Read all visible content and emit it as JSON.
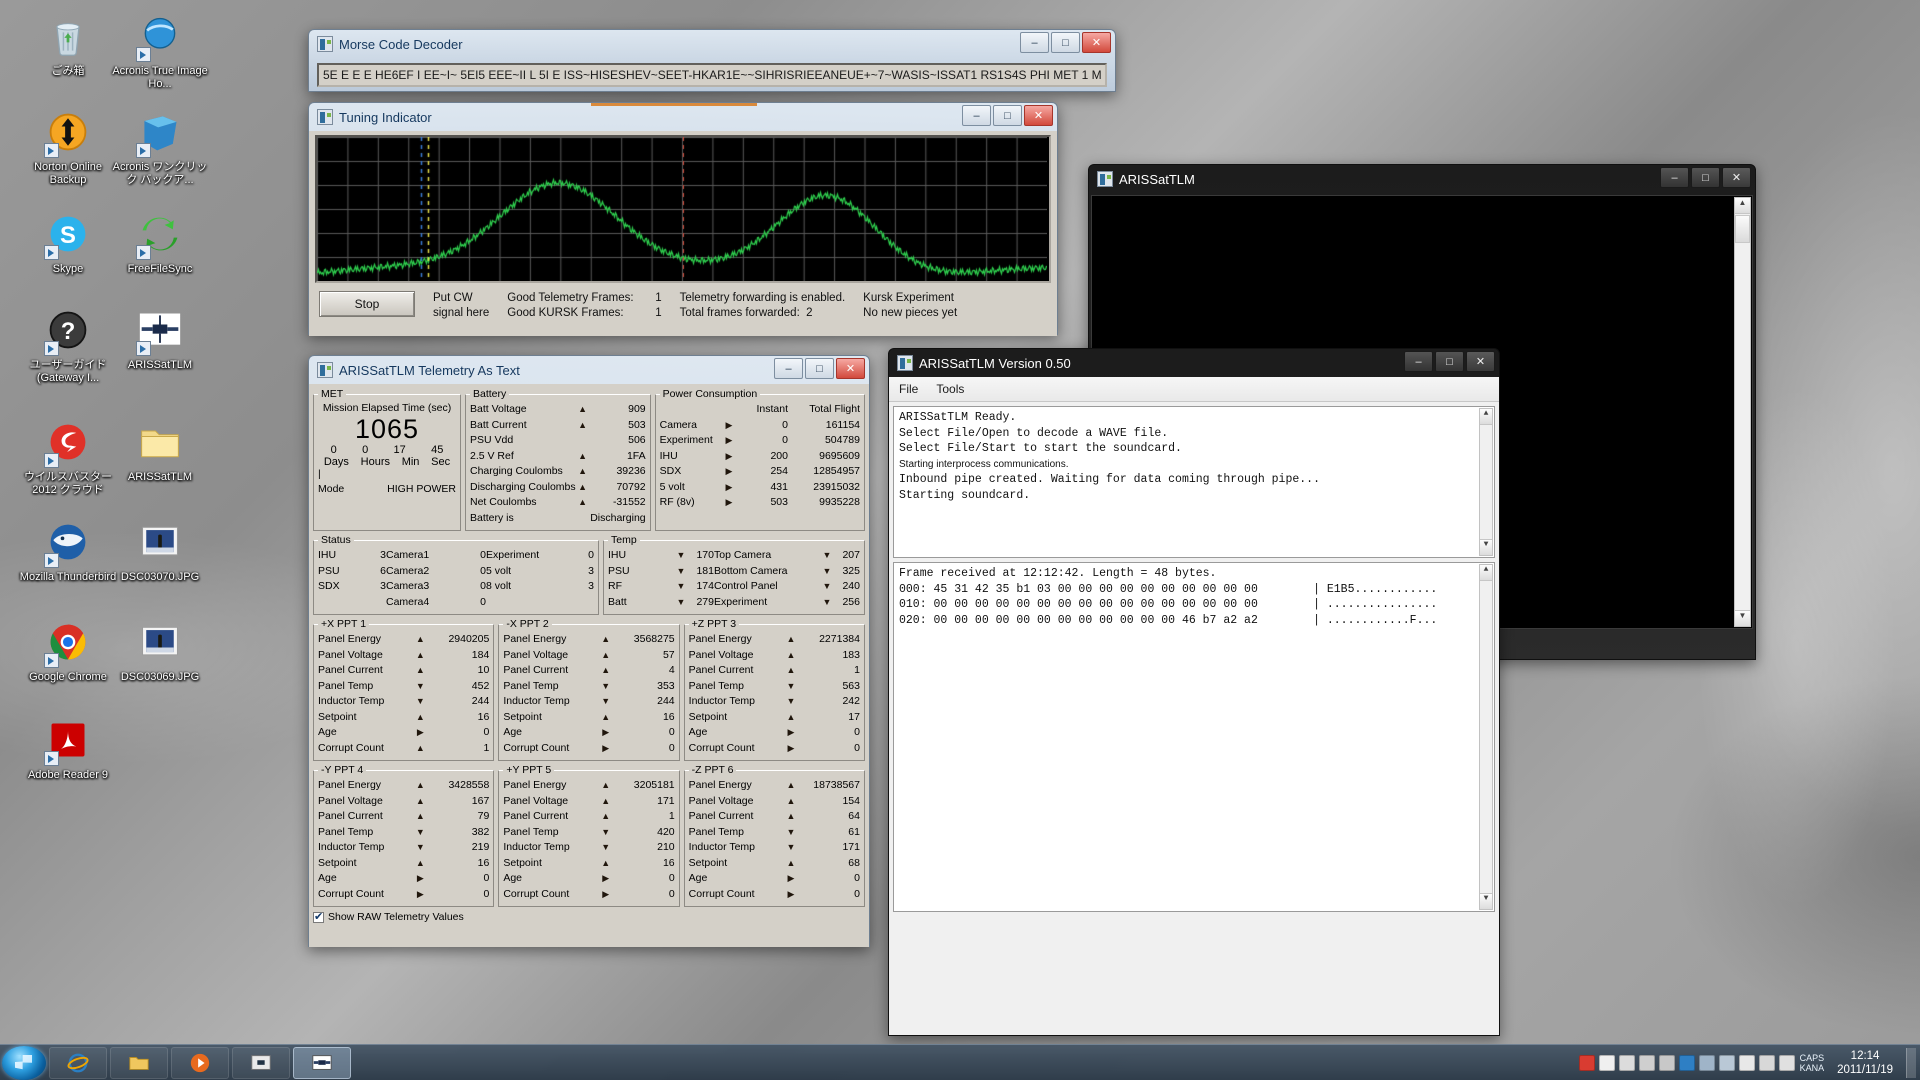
{
  "desktop": {
    "icons": [
      {
        "label": "ごみ箱",
        "icon": "recycle-bin-icon",
        "shortcut": false
      },
      {
        "label": "Acronis True Image Ho...",
        "icon": "acronis-true-image-icon",
        "shortcut": true
      },
      {
        "label": "Norton Online Backup",
        "icon": "norton-online-backup-icon",
        "shortcut": true
      },
      {
        "label": "Acronis ワンクリック バックア...",
        "icon": "acronis-one-click-backup-icon",
        "shortcut": true
      },
      {
        "label": "Skype",
        "icon": "skype-icon",
        "shortcut": true
      },
      {
        "label": "FreeFileSync",
        "icon": "freefilesync-icon",
        "shortcut": true
      },
      {
        "label": "ユーザーガイド (Gateway I...",
        "icon": "user-guide-help-icon",
        "shortcut": true
      },
      {
        "label": "ARISSatTLM",
        "icon": "arissattlm-app-icon",
        "shortcut": true
      },
      {
        "label": "ウイルスバスター 2012 クラウド",
        "icon": "virus-buster-icon",
        "shortcut": true
      },
      {
        "label": "ARISSatTLM",
        "icon": "folder-icon",
        "shortcut": false
      },
      {
        "label": "Mozilla Thunderbird",
        "icon": "thunderbird-icon",
        "shortcut": true
      },
      {
        "label": "DSC03070.JPG",
        "icon": "photo-thumbnail-icon",
        "shortcut": false
      },
      {
        "label": "Google Chrome",
        "icon": "chrome-icon",
        "shortcut": true
      },
      {
        "label": "DSC03069.JPG",
        "icon": "photo-thumbnail-icon",
        "shortcut": false
      },
      {
        "label": "Adobe Reader 9",
        "icon": "adobe-reader-icon",
        "shortcut": true
      }
    ]
  },
  "morse_window": {
    "title": "Morse Code Decoder",
    "decoded_text": "5E E  E E HE6EF I EE~I~ 5EI5 EEE~II L 5I E ISS~HISESHEV~SEET-HKAR1E~~SIHRISRIEEANEUE+~7~WASIS~ISSAT1 RS1S4S PHI MET 1 M",
    "buttons": {
      "minimize": "–",
      "maximize": "□",
      "close": "✕"
    }
  },
  "tuning_window": {
    "title": "Tuning Indicator",
    "buttons": {
      "minimize": "–",
      "maximize": "□",
      "close": "✕"
    },
    "stop_button": "Stop",
    "put_cw_line1": "Put CW",
    "put_cw_line2": "signal here",
    "good_telemetry_label": "Good Telemetry Frames:",
    "good_telemetry_value": "1",
    "good_kursk_label": "Good KURSK Frames:",
    "good_kursk_value": "1",
    "forwarding_status": "Telemetry forwarding is enabled.",
    "total_forwarded_label": "Total frames forwarded:",
    "total_forwarded_value": "2",
    "kursk_experiment_label": "Kursk Experiment",
    "kursk_experiment_status": "No new pieces yet"
  },
  "telemetry_window": {
    "title": "ARISSatTLM Telemetry As Text",
    "buttons": {
      "minimize": "–",
      "maximize": "□",
      "close": "✕"
    },
    "met": {
      "legend": "MET",
      "caption": "Mission Elapsed Time (sec)",
      "seconds": "1065",
      "days": "0",
      "hours": "0",
      "min": "17",
      "sec": "45",
      "days_label": "Days",
      "hours_label": "Hours",
      "min_label": "Min",
      "sec_label": "Sec",
      "mode_label": "Mode",
      "mode_value": "HIGH POWER"
    },
    "battery": {
      "legend": "Battery",
      "rows": [
        {
          "label": "Batt Voltage",
          "arrow": "up",
          "value": "909"
        },
        {
          "label": "Batt Current",
          "arrow": "up",
          "value": "503"
        },
        {
          "label": "PSU Vdd",
          "arrow": "none",
          "value": "506"
        },
        {
          "label": "2.5 V Ref",
          "arrow": "up",
          "value": "1FA"
        },
        {
          "label": "Charging Coulombs",
          "arrow": "up",
          "value": "39236"
        },
        {
          "label": "Discharging Coulombs",
          "arrow": "up",
          "value": "70792"
        },
        {
          "label": "Net Coulombs",
          "arrow": "up",
          "value": "-31552"
        },
        {
          "label": "Battery is",
          "arrow": "none",
          "value": "Discharging"
        }
      ]
    },
    "power": {
      "legend": "Power Consumption",
      "col_instant": "Instant",
      "col_total": "Total Flight",
      "rows": [
        {
          "label": "Camera",
          "arrow": "right",
          "instant": "0",
          "total": "161154"
        },
        {
          "label": "Experiment",
          "arrow": "right",
          "instant": "0",
          "total": "504789"
        },
        {
          "label": "IHU",
          "arrow": "right",
          "instant": "200",
          "total": "9695609"
        },
        {
          "label": "SDX",
          "arrow": "right",
          "instant": "254",
          "total": "12854957"
        },
        {
          "label": "5 volt",
          "arrow": "right",
          "instant": "431",
          "total": "23915032"
        },
        {
          "label": "RF (8v)",
          "arrow": "right",
          "instant": "503",
          "total": "9935228"
        }
      ]
    },
    "status": {
      "legend": "Status",
      "col1": [
        {
          "label": "IHU",
          "value": "3"
        },
        {
          "label": "PSU",
          "value": "6"
        },
        {
          "label": "SDX",
          "value": "3"
        },
        {
          "label": "",
          "value": ""
        }
      ],
      "col2": [
        {
          "label": "Camera1",
          "value": "0"
        },
        {
          "label": "Camera2",
          "value": "0"
        },
        {
          "label": "Camera3",
          "value": "0"
        },
        {
          "label": "Camera4",
          "value": "0"
        }
      ],
      "col3": [
        {
          "label": "Experiment",
          "value": "0"
        },
        {
          "label": "5 volt",
          "value": "3"
        },
        {
          "label": "8 volt",
          "value": "3"
        },
        {
          "label": "",
          "value": ""
        }
      ]
    },
    "temp": {
      "legend": "Temp",
      "col1": [
        {
          "label": "IHU",
          "arrow": "down",
          "value": "170"
        },
        {
          "label": "PSU",
          "arrow": "down",
          "value": "181"
        },
        {
          "label": "RF",
          "arrow": "down",
          "value": "174"
        },
        {
          "label": "Batt",
          "arrow": "down",
          "value": "279"
        }
      ],
      "col2": [
        {
          "label": "Top Camera",
          "arrow": "down",
          "value": "207"
        },
        {
          "label": "Bottom Camera",
          "arrow": "down",
          "value": "325"
        },
        {
          "label": "Control Panel",
          "arrow": "down",
          "value": "240"
        },
        {
          "label": "Experiment",
          "arrow": "down",
          "value": "256"
        }
      ]
    },
    "ppts": [
      {
        "legend": "+X PPT 1",
        "rows": [
          {
            "label": "Panel Energy",
            "arrow": "up",
            "value": "2940205"
          },
          {
            "label": "Panel Voltage",
            "arrow": "up",
            "value": "184"
          },
          {
            "label": "Panel Current",
            "arrow": "up",
            "value": "10"
          },
          {
            "label": "Panel Temp",
            "arrow": "down",
            "value": "452"
          },
          {
            "label": "Inductor Temp",
            "arrow": "down",
            "value": "244"
          },
          {
            "label": "Setpoint",
            "arrow": "up",
            "value": "16"
          },
          {
            "label": "Age",
            "arrow": "right",
            "value": "0"
          },
          {
            "label": "Corrupt Count",
            "arrow": "up",
            "value": "1"
          }
        ]
      },
      {
        "legend": "-X PPT 2",
        "rows": [
          {
            "label": "Panel Energy",
            "arrow": "up",
            "value": "3568275"
          },
          {
            "label": "Panel Voltage",
            "arrow": "up",
            "value": "57"
          },
          {
            "label": "Panel Current",
            "arrow": "up",
            "value": "4"
          },
          {
            "label": "Panel Temp",
            "arrow": "down",
            "value": "353"
          },
          {
            "label": "Inductor Temp",
            "arrow": "down",
            "value": "244"
          },
          {
            "label": "Setpoint",
            "arrow": "up",
            "value": "16"
          },
          {
            "label": "Age",
            "arrow": "right",
            "value": "0"
          },
          {
            "label": "Corrupt Count",
            "arrow": "right",
            "value": "0"
          }
        ]
      },
      {
        "legend": "+Z PPT 3",
        "rows": [
          {
            "label": "Panel Energy",
            "arrow": "up",
            "value": "2271384"
          },
          {
            "label": "Panel Voltage",
            "arrow": "up",
            "value": "183"
          },
          {
            "label": "Panel Current",
            "arrow": "up",
            "value": "1"
          },
          {
            "label": "Panel Temp",
            "arrow": "down",
            "value": "563"
          },
          {
            "label": "Inductor Temp",
            "arrow": "down",
            "value": "242"
          },
          {
            "label": "Setpoint",
            "arrow": "up",
            "value": "17"
          },
          {
            "label": "Age",
            "arrow": "right",
            "value": "0"
          },
          {
            "label": "Corrupt Count",
            "arrow": "right",
            "value": "0"
          }
        ]
      },
      {
        "legend": "-Y PPT 4",
        "rows": [
          {
            "label": "Panel Energy",
            "arrow": "up",
            "value": "3428558"
          },
          {
            "label": "Panel Voltage",
            "arrow": "up",
            "value": "167"
          },
          {
            "label": "Panel Current",
            "arrow": "up",
            "value": "79"
          },
          {
            "label": "Panel Temp",
            "arrow": "down",
            "value": "382"
          },
          {
            "label": "Inductor Temp",
            "arrow": "down",
            "value": "219"
          },
          {
            "label": "Setpoint",
            "arrow": "up",
            "value": "16"
          },
          {
            "label": "Age",
            "arrow": "right",
            "value": "0"
          },
          {
            "label": "Corrupt Count",
            "arrow": "right",
            "value": "0"
          }
        ]
      },
      {
        "legend": "+Y PPT 5",
        "rows": [
          {
            "label": "Panel Energy",
            "arrow": "up",
            "value": "3205181"
          },
          {
            "label": "Panel Voltage",
            "arrow": "up",
            "value": "171"
          },
          {
            "label": "Panel Current",
            "arrow": "up",
            "value": "1"
          },
          {
            "label": "Panel Temp",
            "arrow": "down",
            "value": "420"
          },
          {
            "label": "Inductor Temp",
            "arrow": "down",
            "value": "210"
          },
          {
            "label": "Setpoint",
            "arrow": "up",
            "value": "16"
          },
          {
            "label": "Age",
            "arrow": "right",
            "value": "0"
          },
          {
            "label": "Corrupt Count",
            "arrow": "right",
            "value": "0"
          }
        ]
      },
      {
        "legend": "-Z PPT 6",
        "rows": [
          {
            "label": "Panel Energy",
            "arrow": "up",
            "value": "18738567"
          },
          {
            "label": "Panel Voltage",
            "arrow": "up",
            "value": "154"
          },
          {
            "label": "Panel Current",
            "arrow": "up",
            "value": "64"
          },
          {
            "label": "Panel Temp",
            "arrow": "down",
            "value": "61"
          },
          {
            "label": "Inductor Temp",
            "arrow": "down",
            "value": "171"
          },
          {
            "label": "Setpoint",
            "arrow": "up",
            "value": "68"
          },
          {
            "label": "Age",
            "arrow": "right",
            "value": "0"
          },
          {
            "label": "Corrupt Count",
            "arrow": "right",
            "value": "0"
          }
        ]
      }
    ],
    "show_raw_label": "Show RAW Telemetry Values"
  },
  "arissattlm_black_window": {
    "title": "ARISSatTLM",
    "buttons": {
      "minimize": "–",
      "maximize": "□",
      "close": "✕"
    }
  },
  "arissattlm_version_window": {
    "title": "ARISSatTLM Version 0.50",
    "buttons": {
      "minimize": "–",
      "maximize": "□",
      "close": "✕"
    },
    "menu": [
      "File",
      "Tools"
    ],
    "log_top": [
      "ARISSatTLM Ready.",
      "Select File/Open to decode a WAVE file.",
      "Select File/Start to start the soundcard.",
      "Starting interprocess communications.",
      "Inbound pipe created. Waiting for data coming through pipe...",
      "Starting soundcard."
    ],
    "log_bottom": [
      "Frame received at 12:12:42. Length = 48 bytes.",
      "000: 45 31 42 35 b1 03 00 00 00 00 00 00 00 00 00 00        | E1B5............",
      "010: 00 00 00 00 00 00 00 00 00 00 00 00 00 00 00 00        | ................",
      "020: 00 00 00 00 00 00 00 00 00 00 00 00 46 b7 a2 a2        | ............F..."
    ]
  },
  "taskbar": {
    "start_tooltip": "Start",
    "items": [
      {
        "name": "internet-explorer",
        "label": "Internet Explorer",
        "active": false
      },
      {
        "name": "windows-explorer",
        "label": "Windows Explorer",
        "active": false
      },
      {
        "name": "media-player",
        "label": "Windows Media Player",
        "active": false
      },
      {
        "name": "arissattlm-task",
        "label": "ARISSatTLM",
        "active": false
      },
      {
        "name": "arissattlm-active",
        "label": "ARISSatTLM",
        "active": true
      }
    ],
    "tray": [
      {
        "name": "virus-buster-tray-icon",
        "color": "#d93c31"
      },
      {
        "name": "ime-a-icon",
        "color": "#f0f0f0"
      },
      {
        "name": "ime-kana-icon",
        "color": "#dcdcdc"
      },
      {
        "name": "ime-tool-icon",
        "color": "#cfcfcf"
      },
      {
        "name": "ime-pad-icon",
        "color": "#c8c8c8"
      },
      {
        "name": "ime-help-icon",
        "color": "#2e7fc4"
      },
      {
        "name": "caps-kana-indicator",
        "color": "#9fb4c8"
      },
      {
        "name": "show-hidden-icons-icon",
        "color": "#b9c8d6"
      },
      {
        "name": "action-center-icon",
        "color": "#e8e8e8"
      },
      {
        "name": "network-icon",
        "color": "#d8d8d8"
      },
      {
        "name": "volume-icon",
        "color": "#e0e0e0"
      }
    ],
    "caps_label": "CAPS",
    "kana_label": "KANA",
    "clock_time": "12:14",
    "clock_date": "2011/11/19"
  },
  "colors": {
    "accent": "#1f5fa8",
    "scope_trace": "#2fd24f",
    "marker_red": "#d24b3a",
    "marker_blue": "#3a7bd5",
    "marker_yellow": "#e8e04a",
    "bar_orange": "#d98a3c",
    "window_face": "#d4d0c8"
  }
}
